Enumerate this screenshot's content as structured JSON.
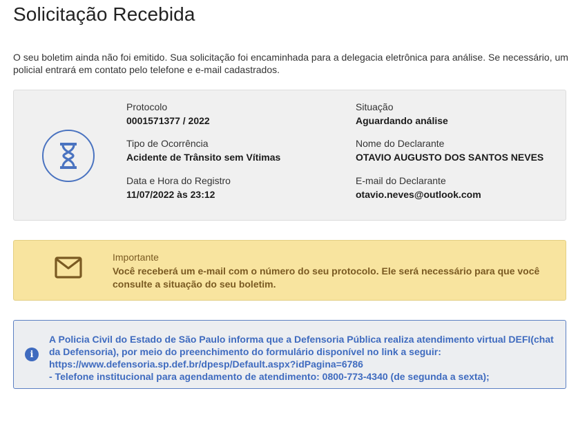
{
  "page": {
    "title": "Solicitação Recebida",
    "intro": "O seu boletim ainda não foi emitido. Sua solicitação foi encaminhada para a delegacia eletrônica para análise. Se necessário, um policial entrará em contato pelo telefone e e-mail cadastrados."
  },
  "details": {
    "status_icon": "hourglass-icon",
    "protocolo": {
      "label": "Protocolo",
      "value": "0001571377 / 2022"
    },
    "situacao": {
      "label": "Situação",
      "value": "Aguardando análise"
    },
    "tipo": {
      "label": "Tipo de Ocorrência",
      "value": "Acidente de Trânsito sem Vítimas"
    },
    "declarante": {
      "label": "Nome do Declarante",
      "value": "OTAVIO AUGUSTO DOS SANTOS NEVES"
    },
    "data_hora": {
      "label": "Data e Hora do Registro",
      "value": "11/07/2022 às 23:12"
    },
    "email": {
      "label": "E-mail do Declarante",
      "value": "otavio.neves@outlook.com"
    }
  },
  "important": {
    "icon": "envelope-icon",
    "label": "Importante",
    "message": "Você receberá um e-mail com o número do seu protocolo. Ele será necessário para que você consulte a situação do seu boletim."
  },
  "info": {
    "icon": "info-icon",
    "glyph": "i",
    "line1": "A Policia Civil do Estado de São Paulo informa que a Defensoria Pública realiza atendimento virtual DEFI(chat da Defensoria), por meio do preenchimento do formulário disponível no link a seguir:",
    "link": "https://www.defensoria.sp.def.br/dpesp/Default.aspx?idPagina=6786",
    "line3": "- Telefone institucional para agendamento de atendimento: 0800-773-4340 (de segunda a sexta);"
  },
  "colors": {
    "accent_blue": "#3f6bbf",
    "warning_bg": "#f8e49f",
    "warning_text": "#7a5a22",
    "card_bg": "#f0f0f0"
  }
}
